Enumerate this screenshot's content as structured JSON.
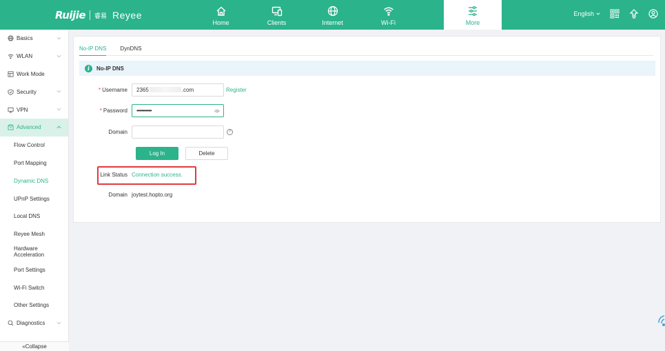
{
  "brand": {
    "logo": "Ruijie",
    "sub_cn": "睿易",
    "sub": "Reyee"
  },
  "nav": [
    {
      "label": "Home",
      "icon": "home-icon"
    },
    {
      "label": "Clients",
      "icon": "clients-icon"
    },
    {
      "label": "Internet",
      "icon": "globe-icon"
    },
    {
      "label": "Wi-Fi",
      "icon": "wifi-icon"
    },
    {
      "label": "More",
      "icon": "sliders-icon",
      "active": true
    }
  ],
  "topright": {
    "language": "English"
  },
  "sidebar": {
    "items": [
      {
        "label": "Basics",
        "icon": "globe-icon"
      },
      {
        "label": "WLAN",
        "icon": "wifi-icon"
      },
      {
        "label": "Work Mode",
        "icon": "grid-icon"
      },
      {
        "label": "Security",
        "icon": "shield-icon"
      },
      {
        "label": "VPN",
        "icon": "monitor-icon"
      },
      {
        "label": "Advanced",
        "icon": "package-icon"
      }
    ],
    "sub_items": [
      "Flow Control",
      "Port Mapping",
      "Dynamic DNS",
      "UPnP Settings",
      "Local DNS",
      "Reyee Mesh",
      "Hardware Acceleration",
      "Port Settings",
      "Wi-Fi Switch",
      "Other Settings"
    ],
    "bottom_item": {
      "label": "Diagnostics",
      "icon": "search-icon"
    },
    "collapse_label": "Collapse"
  },
  "tabs": [
    "No-IP DNS",
    "DynDNS"
  ],
  "section_title": "No-IP DNS",
  "form": {
    "username_label": "Username",
    "username_prefix": "2365",
    "username_suffix": ".com",
    "register_link": "Register",
    "password_label": "Password",
    "password_mask": "••••••••••••",
    "domain_label": "Domain",
    "domain_value": "",
    "login_button": "Log In",
    "delete_button": "Delete",
    "link_status_label": "Link Status",
    "link_status_value": "Connection success.",
    "domain_result_label": "Domain",
    "domain_result_value": "joytest.hopto.org"
  },
  "colors": {
    "accent": "#2bb38b",
    "highlight": "#e0393e",
    "info_bg": "#e9f4fb"
  }
}
